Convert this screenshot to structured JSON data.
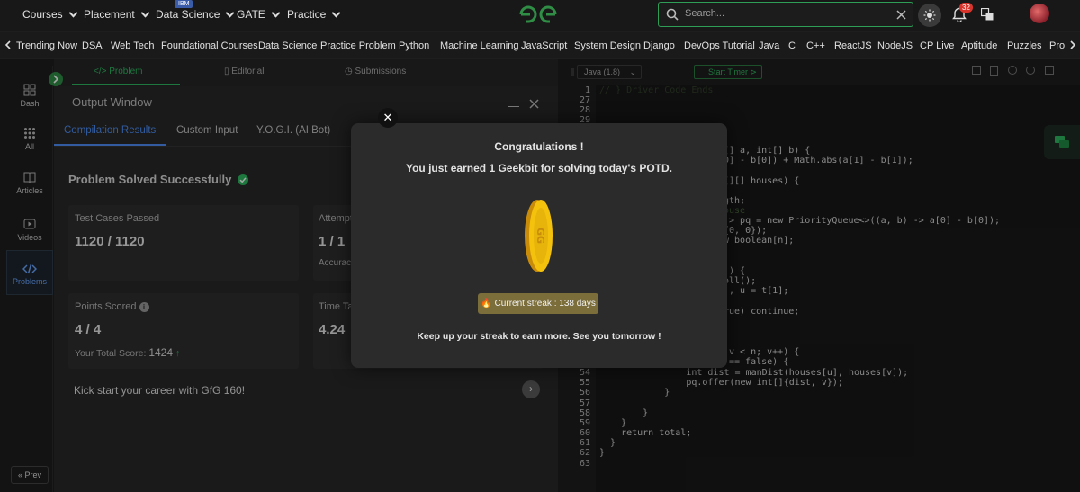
{
  "topnav": {
    "items": [
      {
        "label": "Courses"
      },
      {
        "label": "Placement"
      },
      {
        "label": "Data Science"
      },
      {
        "label": "GATE"
      },
      {
        "label": "Practice"
      }
    ],
    "ibm_badge": "IBM",
    "search_placeholder": "Search...",
    "notification_count": "32",
    "icons": [
      "search-icon",
      "close-icon",
      "theme-icon",
      "bell-icon",
      "translate-icon",
      "avatar"
    ]
  },
  "subnav": {
    "items": [
      "Trending Now",
      "DSA",
      "Web Tech",
      "Foundational Courses",
      "Data Science",
      "Practice Problem",
      "Python",
      "Machine Learning",
      "JavaScript",
      "System Design",
      "Django",
      "DevOps Tutorial",
      "Java",
      "C",
      "C++",
      "ReactJS",
      "NodeJS",
      "CP Live",
      "Aptitude",
      "Puzzles",
      "Pro"
    ]
  },
  "sidebar": {
    "items": [
      {
        "label": "Dash",
        "icon": "grid-icon"
      },
      {
        "label": "All",
        "icon": "apps-icon"
      },
      {
        "label": "Articles",
        "icon": "book-icon"
      },
      {
        "label": "Videos",
        "icon": "play-icon"
      },
      {
        "label": "Problems",
        "icon": "code-icon",
        "active": true
      }
    ],
    "prev_label": "Prev"
  },
  "problem_tabs": [
    "Problem",
    "Editorial",
    "Submissions"
  ],
  "output_window": {
    "title": "Output Window",
    "tabs": [
      "Compilation Results",
      "Custom Input",
      "Y.O.G.I. (AI Bot)"
    ],
    "solved_title": "Problem Solved Successfully",
    "cards": {
      "tests_label": "Test Cases Passed",
      "tests_value": "1120 / 1120",
      "attempts_label": "Attempts",
      "attempts_value": "1 / 1",
      "accuracy_label": "Accuracy",
      "points_label": "Points Scored",
      "points_value": "4 / 4",
      "total_score_label": "Your Total Score:",
      "total_score_value": "1424",
      "time_label": "Time Taken",
      "time_value": "4.24"
    },
    "kickstart": "Kick start your career with GfG 160!"
  },
  "editor": {
    "language": "Java (1.8)",
    "timer_label": "Start Timer",
    "line_numbers": [
      "1",
      "27",
      "28",
      "29",
      "54",
      "55",
      "56",
      "57",
      "58",
      "59",
      "60",
      "61",
      "62",
      "63"
    ],
    "code_lines": {
      "l1": "// } Driver Code Ends",
      "f1": "[] a, int[] b) {",
      "f2": "0] - b[0]) + Math.abs(a[1] - b[1]);",
      "f3": "[][] houses) {",
      "f4": "gth;",
      "f5": "ouse",
      "f6": "]> pq = new PriorityQueue<>((a, b) -> a[0] - b[0]);",
      "f7": "{0, 0});",
      "f8": "w boolean[n];",
      "f9": ")) {",
      "f10": "oll();",
      "f11": "], u = t[1];",
      "f12": "rue) continue;",
      "f13": "v < n; v++) {",
      "f14": "== false) {",
      "l54": "                int dist = manDist(houses[u], houses[v]);",
      "l55": "                pq.offer(new int[]{dist, v});",
      "l56": "            }",
      "l57": "",
      "l58": "        }",
      "l59": "    }",
      "l60": "    return total;",
      "l61": "  }",
      "l62": "}",
      "l63": ""
    }
  },
  "modal": {
    "title": "Congratulations !",
    "subtitle": "You just earned 1 Geekbit for solving today's POTD.",
    "streak": "Current streak : 138 days",
    "footer": "Keep up your streak to earn more. See you tomorrow !"
  }
}
